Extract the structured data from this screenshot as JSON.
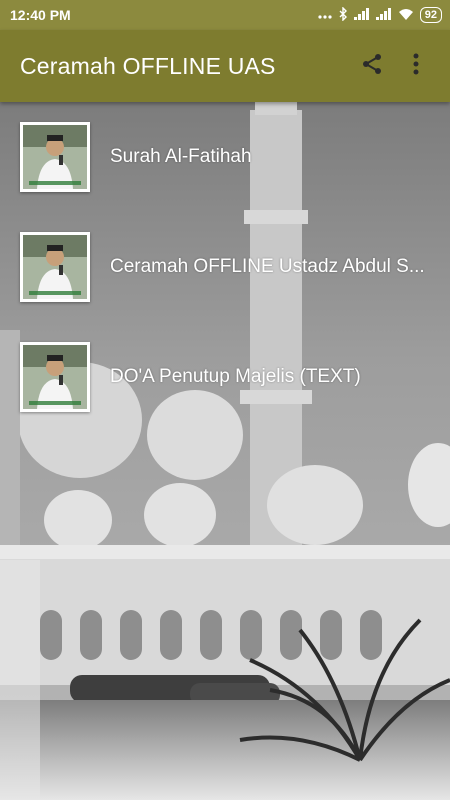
{
  "status_bar": {
    "time": "12:40 PM",
    "icons": [
      "dots-icon",
      "bluetooth-icon",
      "signal-icon",
      "signal-icon",
      "wifi-icon"
    ],
    "battery": "92"
  },
  "app_bar": {
    "title": "Ceramah OFFLINE UAS",
    "actions": [
      "share-icon",
      "more-vert-icon"
    ]
  },
  "list": {
    "items": [
      {
        "label": "Surah Al-Fatihah"
      },
      {
        "label": "Ceramah OFFLINE Ustadz Abdul S..."
      },
      {
        "label": "DO'A Penutup Majelis (TEXT)"
      }
    ]
  },
  "colors": {
    "status_bar": "#8c8a3e",
    "app_bar": "#7e7c2f",
    "text": "#ffffff"
  }
}
